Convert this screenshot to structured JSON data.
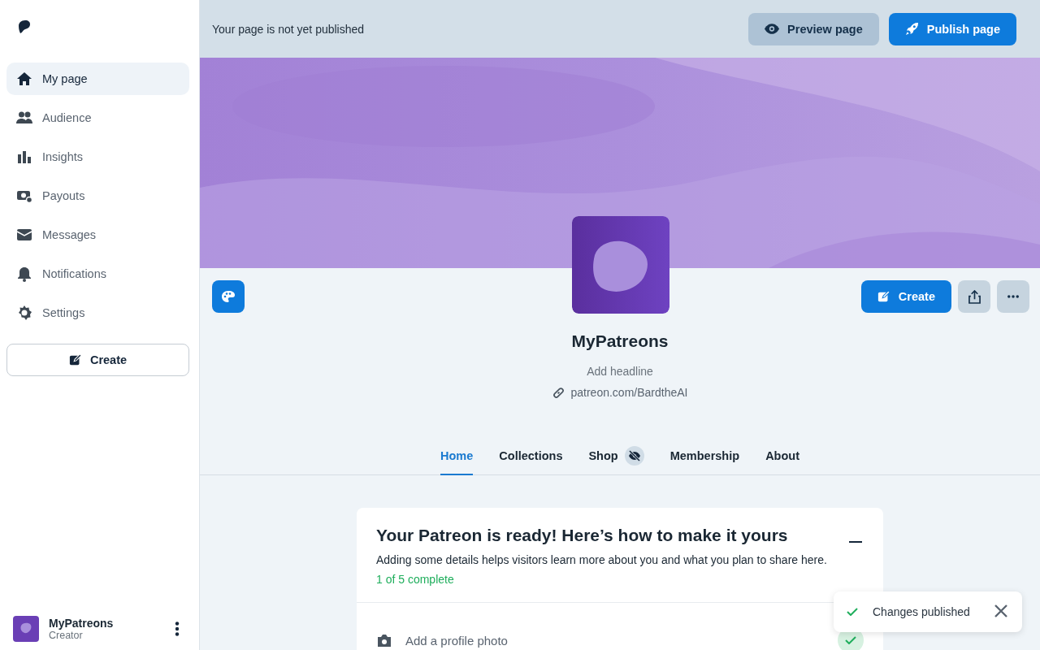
{
  "sidebar": {
    "nav": [
      {
        "label": "My page",
        "selected": true
      },
      {
        "label": "Audience",
        "selected": false
      },
      {
        "label": "Insights",
        "selected": false
      },
      {
        "label": "Payouts",
        "selected": false
      },
      {
        "label": "Messages",
        "selected": false
      },
      {
        "label": "Notifications",
        "selected": false
      },
      {
        "label": "Settings",
        "selected": false
      }
    ],
    "create_button": "Create",
    "account": {
      "name": "MyPatreons",
      "role": "Creator"
    }
  },
  "top_bar": {
    "status": "Your page is not yet published",
    "preview_button": "Preview page",
    "publish_button": "Publish page"
  },
  "profile": {
    "name": "MyPatreons",
    "headline_placeholder": "Add headline",
    "url": "patreon.com/BardtheAI",
    "create_button": "Create"
  },
  "tabs": [
    {
      "label": "Home",
      "selected": true,
      "hidden": false
    },
    {
      "label": "Collections",
      "selected": false,
      "hidden": false
    },
    {
      "label": "Shop",
      "selected": false,
      "hidden": true
    },
    {
      "label": "Membership",
      "selected": false,
      "hidden": false
    },
    {
      "label": "About",
      "selected": false,
      "hidden": false
    }
  ],
  "checklist": {
    "title": "Your Patreon is ready! Here’s how to make it yours",
    "description": "Adding some details helps visitors learn more about you and what you plan to share here.",
    "progress": "1 of 5 complete",
    "items": [
      {
        "label": "Add a profile photo",
        "done": true
      }
    ]
  },
  "toast": {
    "message": "Changes published"
  }
}
